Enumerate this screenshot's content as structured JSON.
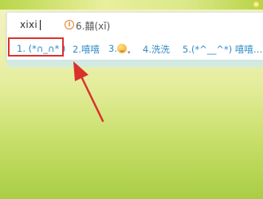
{
  "ime": {
    "input": "xixi",
    "hint": "6.囍(xǐ)",
    "info_glyph": "i",
    "candidates": [
      {
        "label": "1. (*∩_∩* )"
      },
      {
        "label": "2.嘻嘻"
      },
      {
        "label": "3."
      },
      {
        "label": "4.洗洗"
      },
      {
        "label": "5.(*^__^*) 嘻嘻……"
      }
    ],
    "emoji_icon": "smiling-face-emoji",
    "dropdown_glyph": "▾"
  },
  "annotation": {
    "box_color": "#d9312b",
    "arrow_color": "#d9312b"
  },
  "colors": {
    "candidate_text": "#2f8bc6",
    "info_icon": "#e67e22"
  }
}
